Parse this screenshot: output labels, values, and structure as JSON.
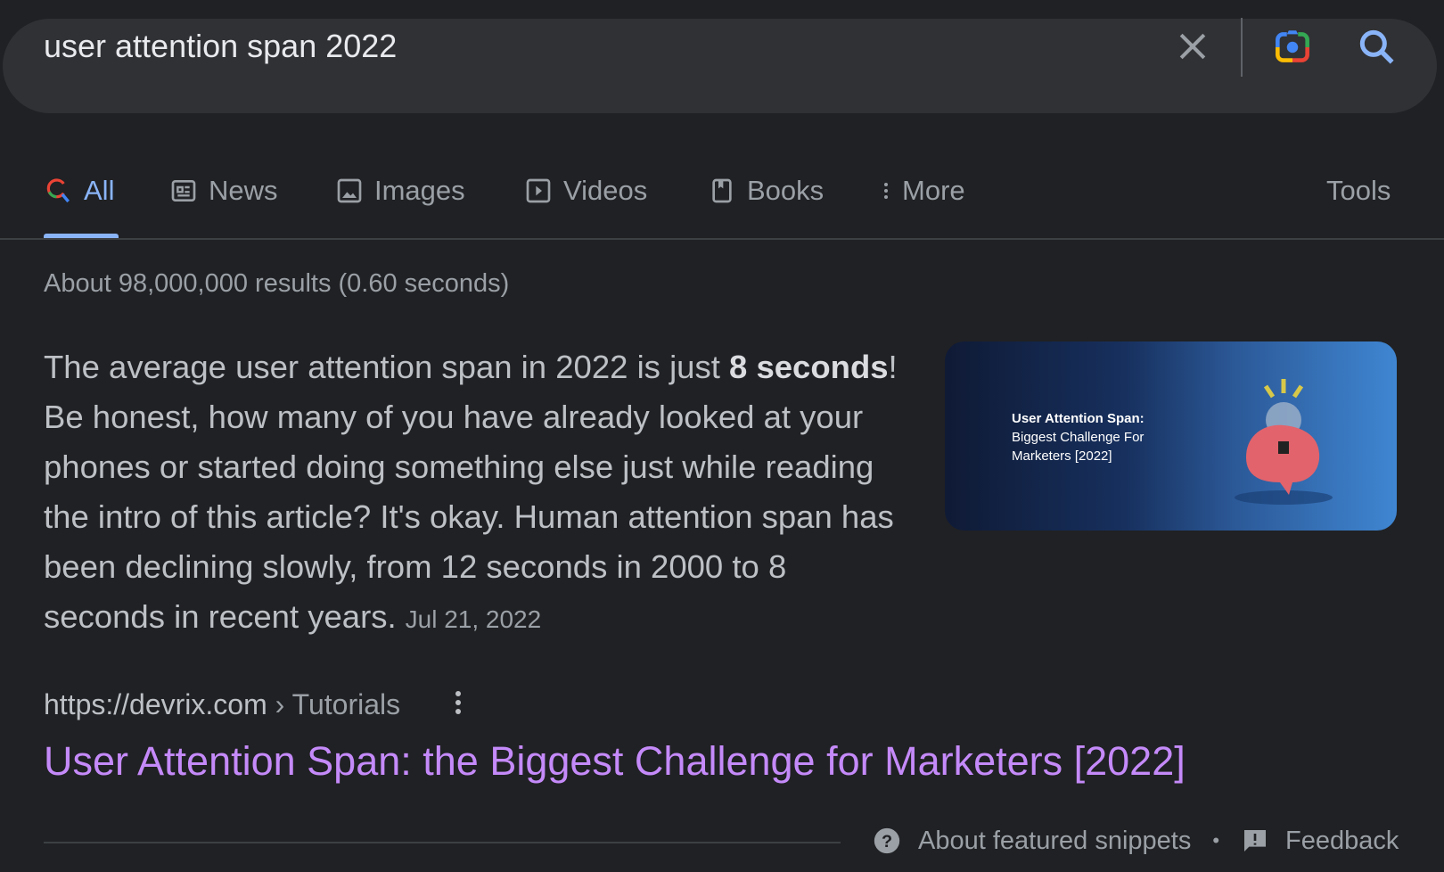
{
  "search": {
    "query": "user attention span 2022"
  },
  "tabs": [
    {
      "label": "All",
      "icon": "google-search-icon",
      "active": true
    },
    {
      "label": "News",
      "icon": "news-icon"
    },
    {
      "label": "Images",
      "icon": "image-icon"
    },
    {
      "label": "Videos",
      "icon": "play-icon"
    },
    {
      "label": "Books",
      "icon": "book-icon"
    },
    {
      "label": "More",
      "icon": "more-vert-icon"
    }
  ],
  "tools_label": "Tools",
  "result_stats": "About 98,000,000 results (0.60 seconds)",
  "snippet": {
    "pre": "The average user attention span in 2022 is just ",
    "bold": "8 seconds",
    "post": "! Be honest, how many of you have already looked at your phones or started doing something else just while reading the intro of this article? It's okay. Human attention span has been declining slowly, from 12 seconds in 2000 to 8 seconds in recent years.",
    "date": "Jul 21, 2022",
    "image_title": "User Attention Span:",
    "image_subtitle": "Biggest Challenge For Marketers [2022]"
  },
  "result": {
    "url": "https://devrix.com",
    "breadcrumb": " › Tutorials",
    "title": "User Attention Span: the Biggest Challenge for Marketers [2022]"
  },
  "footer": {
    "about": "About featured snippets",
    "sep": "•",
    "feedback": "Feedback"
  },
  "colors": {
    "bg": "#202124",
    "accent": "#8ab4f8",
    "visited_link": "#c58af9"
  }
}
